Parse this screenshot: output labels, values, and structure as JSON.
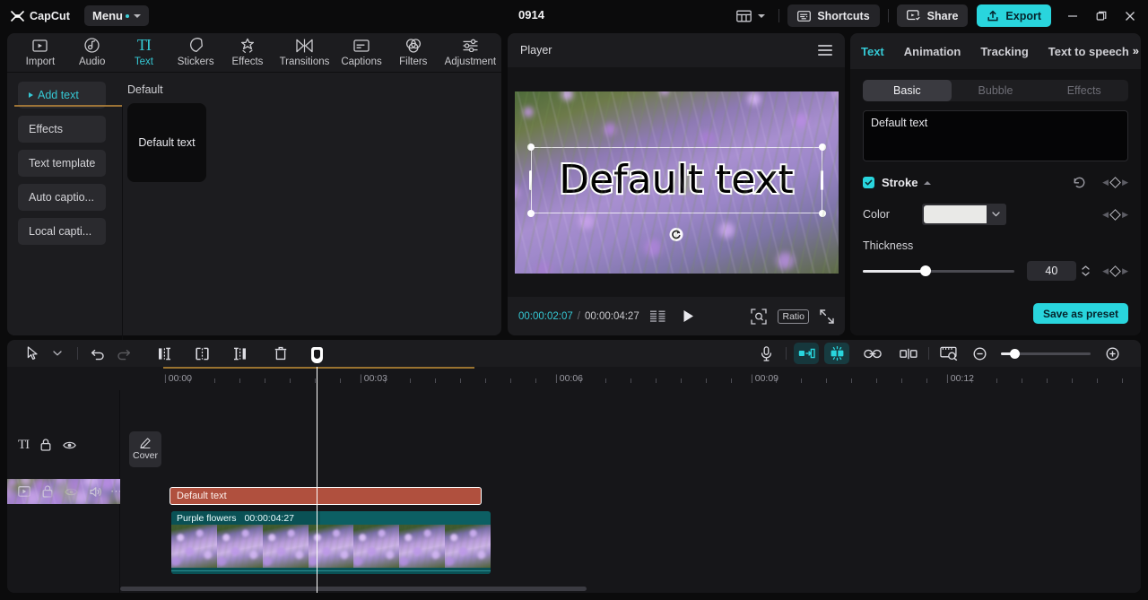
{
  "titlebar": {
    "brand": "CapCut",
    "menu_label": "Menu",
    "project_title": "0914",
    "layout_icon": "layout-icon",
    "shortcuts_label": "Shortcuts",
    "share_label": "Share",
    "export_label": "Export",
    "minimize_icon": "minimize-icon",
    "restore_icon": "restore-icon",
    "close_icon": "close-icon",
    "accent_color": "#29d5dd"
  },
  "left_panel": {
    "tabs": [
      {
        "label": "Import",
        "icon": "import-icon",
        "active": false
      },
      {
        "label": "Audio",
        "icon": "audio-icon",
        "active": false
      },
      {
        "label": "Text",
        "icon": "text-icon",
        "active": true
      },
      {
        "label": "Stickers",
        "icon": "stickers-icon",
        "active": false
      },
      {
        "label": "Effects",
        "icon": "effects-icon",
        "active": false
      },
      {
        "label": "Transitions",
        "icon": "transitions-icon",
        "active": false
      },
      {
        "label": "Captions",
        "icon": "captions-icon",
        "active": false
      },
      {
        "label": "Filters",
        "icon": "filters-icon",
        "active": false
      },
      {
        "label": "Adjustment",
        "icon": "adjustment-icon",
        "active": false
      }
    ],
    "nav": [
      {
        "label": "Add text",
        "active": true
      },
      {
        "label": "Effects",
        "active": false
      },
      {
        "label": "Text template",
        "active": false
      },
      {
        "label": "Auto captio...",
        "active": false
      },
      {
        "label": "Local capti...",
        "active": false
      }
    ],
    "section_label": "Default",
    "preset_card_label": "Default text"
  },
  "player": {
    "title": "Player",
    "menu_icon": "hamburger-icon",
    "stage_text": "Default text",
    "rotate_icon": "rotate-handle-icon",
    "current_time": "00:00:02:07",
    "time_separator": "/",
    "total_time": "00:00:04:27",
    "frames_icon": "frames-icon",
    "play_icon": "play-icon",
    "zoom_icon": "zoom-preview-icon",
    "ratio_label": "Ratio",
    "fullscreen_icon": "fullscreen-icon"
  },
  "right_panel": {
    "tabs": [
      {
        "label": "Text",
        "active": true
      },
      {
        "label": "Animation",
        "active": false
      },
      {
        "label": "Tracking",
        "active": false
      },
      {
        "label": "Text to speech",
        "active": false
      }
    ],
    "overflow_label": "»",
    "segments": [
      {
        "label": "Basic",
        "active": true
      },
      {
        "label": "Bubble",
        "active": false
      },
      {
        "label": "Effects",
        "active": false
      }
    ],
    "text_value": "Default text",
    "stroke": {
      "title": "Stroke",
      "enabled": true,
      "reset_icon": "reset-icon",
      "keyframe_icon": "keyframe-diamond-icon",
      "color_label": "Color",
      "color_value": "#e9e9e7",
      "color_dropdown_icon": "chevron-down-icon",
      "thickness_label": "Thickness",
      "thickness_value": "40",
      "thickness_min": 0,
      "thickness_max": 100
    },
    "save_preset_label": "Save as preset"
  },
  "timeline": {
    "toolbar": {
      "select_icon": "cursor-select-icon",
      "select_dropdown_icon": "chevron-down-icon",
      "undo_icon": "undo-icon",
      "redo_icon": "redo-icon",
      "split_left_icon": "trim-left-icon",
      "split_icon": "split-icon",
      "split_right_icon": "trim-right-icon",
      "delete_icon": "delete-icon",
      "mic_icon": "microphone-icon",
      "keyframe_track_icon": "mirror-icon",
      "magnet_icon": "snap-icon",
      "link_icon": "link-icon",
      "crop_icon": "crop-icon",
      "preview_icon": "thumbnail-preview-icon",
      "zoom_out_icon": "zoom-out-icon",
      "zoom_in_icon": "zoom-in-icon",
      "zoom_value": 12
    },
    "ruler_labels": [
      "00:00",
      "00:03",
      "00:06",
      "00:09",
      "00:12"
    ],
    "tracks": [
      {
        "type": "text",
        "icons": [
          "text-track-icon",
          "lock-icon",
          "eye-icon"
        ],
        "clip_label": "Default text"
      },
      {
        "type": "video",
        "icons": [
          "video-track-icon",
          "lock-icon",
          "eye-icon",
          "volume-icon",
          "more-icon"
        ],
        "cover_label": "Cover",
        "cover_icon": "pencil-icon",
        "clip_label": "Purple flowers",
        "clip_duration": "00:00:04:27"
      }
    ]
  }
}
